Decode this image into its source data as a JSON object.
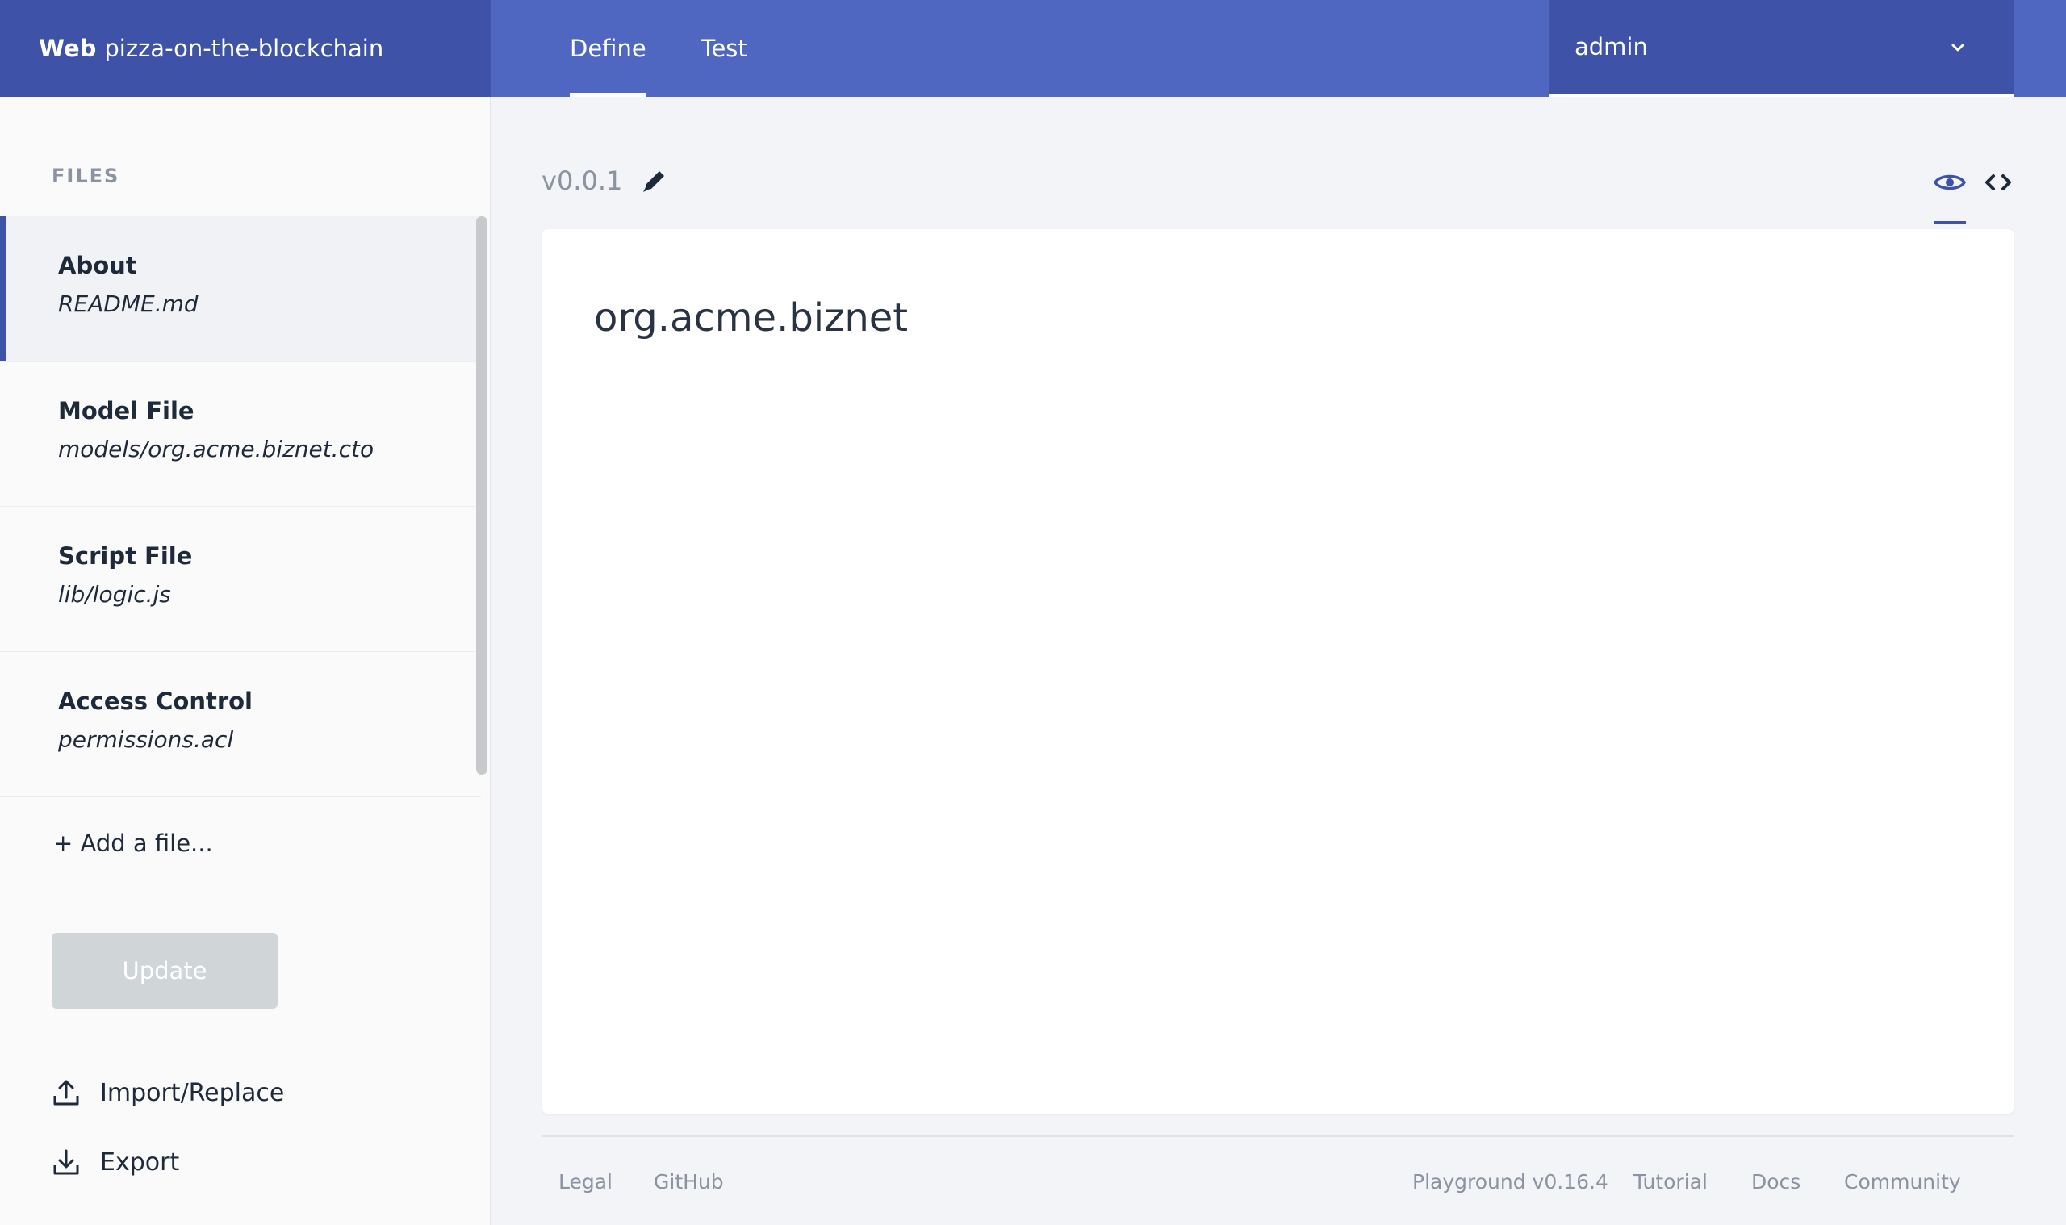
{
  "header": {
    "brand_strong": "Web",
    "brand_name": "pizza-on-the-blockchain",
    "tabs": [
      {
        "label": "Define",
        "active": true
      },
      {
        "label": "Test",
        "active": false
      }
    ],
    "identity": "admin"
  },
  "sidebar": {
    "title": "FILES",
    "files": [
      {
        "name": "About",
        "path": "README.md",
        "active": true
      },
      {
        "name": "Model File",
        "path": "models/org.acme.biznet.cto",
        "active": false
      },
      {
        "name": "Script File",
        "path": "lib/logic.js",
        "active": false
      },
      {
        "name": "Access Control",
        "path": "permissions.acl",
        "active": false
      }
    ],
    "add_file": "+ Add a file...",
    "update_label": "Update",
    "import_label": "Import/Replace",
    "export_label": "Export"
  },
  "main": {
    "version": "v0.0.1",
    "view_mode": "preview",
    "document_heading": "org.acme.biznet"
  },
  "footer": {
    "legal": "Legal",
    "github": "GitHub",
    "playground_version": "Playground v0.16.4",
    "tutorial": "Tutorial",
    "docs": "Docs",
    "community": "Community"
  },
  "colors": {
    "header": "#5067c1",
    "header_dark": "#3e53a8",
    "sidebar": "#fafafa",
    "background": "#f3f4f8",
    "update_disabled": "#d0d5d8"
  }
}
